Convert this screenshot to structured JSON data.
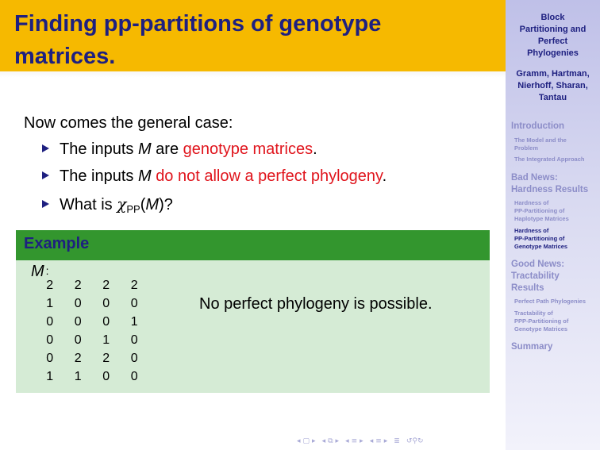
{
  "title": {
    "line1": "Finding pp-partitions of genotype",
    "line2": "matrices."
  },
  "sidebar": {
    "title_lines": [
      "Block",
      "Partitioning and",
      "Perfect",
      "Phylogenies"
    ],
    "author_lines": [
      "Gramm, Hartman,",
      "Nierhoff, Sharan,",
      "Tantau"
    ],
    "sections": [
      {
        "label_lines": [
          "Introduction"
        ],
        "items": [
          {
            "lines": [
              "The Model and the",
              "Problem"
            ],
            "current": false
          },
          {
            "lines": [
              "The Integrated Approach"
            ],
            "current": false
          }
        ]
      },
      {
        "label_lines": [
          "Bad News:",
          "Hardness Results"
        ],
        "items": [
          {
            "lines": [
              "Hardness of",
              "PP-Partitioning of",
              "Haplotype Matrices"
            ],
            "current": false
          },
          {
            "lines": [
              "Hardness of",
              "PP-Partitioning of",
              "Genotype Matrices"
            ],
            "current": true
          }
        ]
      },
      {
        "label_lines": [
          "Good News:",
          "Tractability",
          "Results"
        ],
        "items": [
          {
            "lines": [
              "Perfect Path Phylogenies"
            ],
            "current": false
          },
          {
            "lines": [
              "Tractability of",
              "PPP-Partitioning of",
              "Genotype Matrices"
            ],
            "current": false
          }
        ]
      },
      {
        "label_lines": [
          "Summary"
        ],
        "items": []
      }
    ]
  },
  "body": {
    "intro": "Now comes the general case:",
    "bullets": [
      {
        "pre": "The inputs ",
        "var": "M",
        "mid": " are ",
        "highlight": "genotype matrices",
        "post": "."
      },
      {
        "pre": "The inputs ",
        "var": "M",
        "mid": " ",
        "highlight": "do not allow a perfect phylogeny",
        "post": "."
      },
      {
        "pre": "What is ",
        "chi": "χ",
        "sub": "PP",
        "open": "(",
        "var": "M",
        "close": ")?"
      }
    ]
  },
  "example": {
    "heading": "Example",
    "matrix_label": "M",
    "matrix_colon": ":",
    "matrix": [
      [
        "2",
        "2",
        "2",
        "2"
      ],
      [
        "1",
        "0",
        "0",
        "0"
      ],
      [
        "0",
        "0",
        "0",
        "1"
      ],
      [
        "0",
        "0",
        "1",
        "0"
      ],
      [
        "0",
        "2",
        "2",
        "0"
      ],
      [
        "1",
        "1",
        "0",
        "0"
      ]
    ],
    "note": "No perfect phylogeny is possible."
  },
  "colors": {
    "title_bg": "#f6b900",
    "title_text": "#1e2080",
    "highlight_red": "#e0141c",
    "example_header": "#33962e",
    "example_body": "#d5ebd5"
  }
}
